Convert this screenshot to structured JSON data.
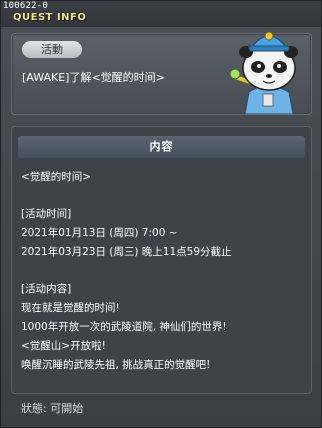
{
  "window": {
    "quest_id": "100622-0",
    "title": "QUEST INFO"
  },
  "header": {
    "category": "活動",
    "quest_name": "[AWAKE]了解<觉醒的时间>"
  },
  "content": {
    "heading": "内容",
    "block1": [
      "<觉醒的时间>"
    ],
    "block2": [
      "[活动时间]",
      "2021年01月13日 (周四) 7:00 ~",
      "2021年03月23日 (周三) 晚上11点59分截止"
    ],
    "block3": [
      "[活动内容]",
      "现在就是觉醒的时间!",
      "1000年开放一次的武陵道院, 神仙们的世界!",
      "<觉醒山>开放啦!",
      "唤醒沉睡的武陵先祖, 挑战真正的觉醒吧!"
    ]
  },
  "status": "狀態: 可開始",
  "colors": {
    "title": "#f2e68a",
    "panel": "#3f4349",
    "heading_bar": "#4f5a66"
  },
  "icons": {
    "close": "close-icon",
    "npc": "panda-npc-portrait"
  }
}
